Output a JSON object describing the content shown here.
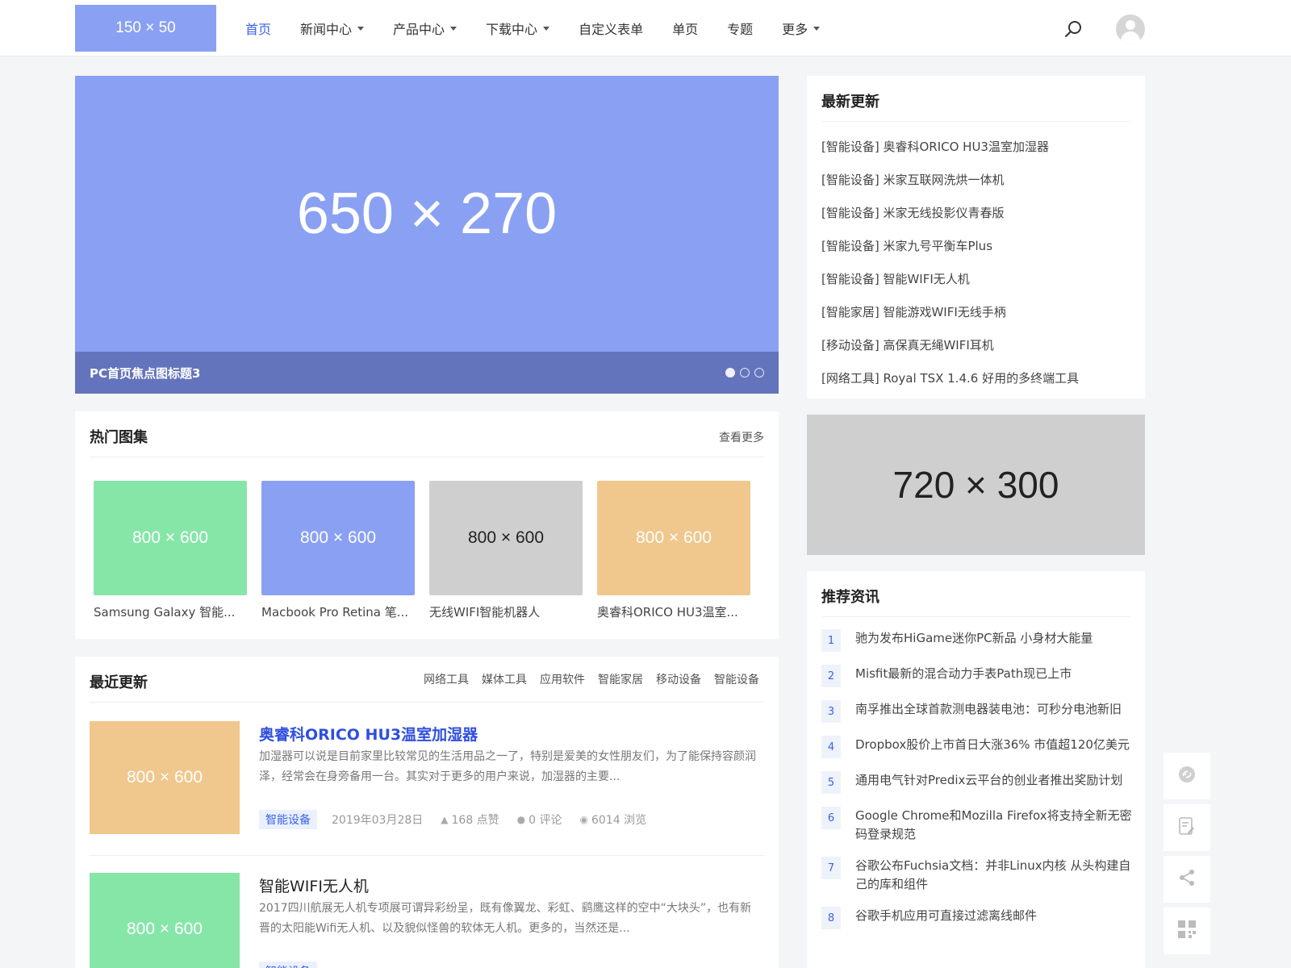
{
  "header": {
    "logo": "150 × 50",
    "nav": [
      {
        "label": "首页",
        "active": true,
        "dropdown": false
      },
      {
        "label": "新闻中心",
        "active": false,
        "dropdown": true
      },
      {
        "label": "产品中心",
        "active": false,
        "dropdown": true
      },
      {
        "label": "下载中心",
        "active": false,
        "dropdown": true
      },
      {
        "label": "自定义表单",
        "active": false,
        "dropdown": false
      },
      {
        "label": "单页",
        "active": false,
        "dropdown": false
      },
      {
        "label": "专题",
        "active": false,
        "dropdown": false
      },
      {
        "label": "更多",
        "active": false,
        "dropdown": true
      }
    ]
  },
  "slider": {
    "placeholder": "650 × 270",
    "caption": "PC首页焦点图标题3",
    "slide_count": 3,
    "active_slide": 1
  },
  "gallery": {
    "title": "热门图集",
    "more": "查看更多",
    "items": [
      {
        "img": "800 × 600",
        "caption": "Samsung Galaxy 智能...",
        "color": "#86e6a8",
        "text_color": "#ffffff"
      },
      {
        "img": "800 × 600",
        "caption": "Macbook Pro Retina 笔...",
        "color": "#8aa0f3",
        "text_color": "#ffffff"
      },
      {
        "img": "800 × 600",
        "caption": "无线WIFI智能机器人",
        "color": "#cfcfcf",
        "text_color": "#222222"
      },
      {
        "img": "800 × 600",
        "caption": "奥睿科ORICO HU3温室...",
        "color": "#f0c78d",
        "text_color": "#ffffff"
      }
    ]
  },
  "recent": {
    "title": "最近更新",
    "tabs": [
      "网络工具",
      "媒体工具",
      "应用软件",
      "智能家居",
      "移动设备",
      "智能设备"
    ],
    "posts": [
      {
        "img": "800 × 600",
        "img_color": "#f0c78d",
        "title": "奥睿科ORICO HU3温室加湿器",
        "summary": "加湿器可以说是目前家里比较常见的生活用品之一了，特别是爱美的女性朋友们，为了能保持容颜润泽，经常会在身旁备用一台。其实对于更多的用户来说，加湿器的主要...",
        "category": "智能设备",
        "date": "2019年03月28日",
        "likes": "168 点赞",
        "comments": "0 评论",
        "views": "6014 浏览"
      },
      {
        "img": "800 × 600",
        "img_color": "#86e6a8",
        "title": "智能WIFI无人机",
        "summary": "2017四川航展无人机专项展可谓异彩纷呈，既有像翼龙、彩虹、鹞鹰这样的空中“大块头”，也有新晋的太阳能Wifi无人机、以及貌似怪兽的软体无人机。更多的，当然还是...",
        "category": "智能设备"
      }
    ]
  },
  "latest": {
    "title": "最新更新",
    "items": [
      "[智能设备] 奥睿科ORICO HU3温室加湿器",
      "[智能设备] 米家互联网洗烘一体机",
      "[智能设备] 米家无线投影仪青春版",
      "[智能设备] 米家九号平衡车Plus",
      "[智能设备] 智能WIFI无人机",
      "[智能家居] 智能游戏WIFI无线手柄",
      "[移动设备] 高保真无绳WIFI耳机",
      "[网络工具] Royal TSX 1.4.6 好用的多终端工具"
    ]
  },
  "ad": {
    "placeholder": "720 × 300"
  },
  "recommend": {
    "title": "推荐资讯",
    "items": [
      {
        "n": "1",
        "text": "驰为发布HiGame迷你PC新品 小身材大能量"
      },
      {
        "n": "2",
        "text": "Misfit最新的混合动力手表Path现已上市"
      },
      {
        "n": "3",
        "text": "南孚推出全球首款测电器装电池：可秒分电池新旧"
      },
      {
        "n": "4",
        "text": "Dropbox股价上市首日大涨36% 市值超120亿美元"
      },
      {
        "n": "5",
        "text": "通用电气针对Predix云平台的创业者推出奖励计划"
      },
      {
        "n": "6",
        "text": "Google Chrome和Mozilla Firefox将支持全新无密码登录规范"
      },
      {
        "n": "7",
        "text": "谷歌公布Fuchsia文档：并非Linux内核 从头构建自己的库和组件"
      },
      {
        "n": "8",
        "text": "谷歌手机应用可直接过滤离线邮件"
      }
    ]
  },
  "tools": [
    "link-icon",
    "edit-icon",
    "share-icon",
    "qrcode-icon"
  ],
  "colors": {
    "accent": "#3b63e6",
    "slider": "#8aa0f3",
    "slider_bar": "#6474bc"
  }
}
